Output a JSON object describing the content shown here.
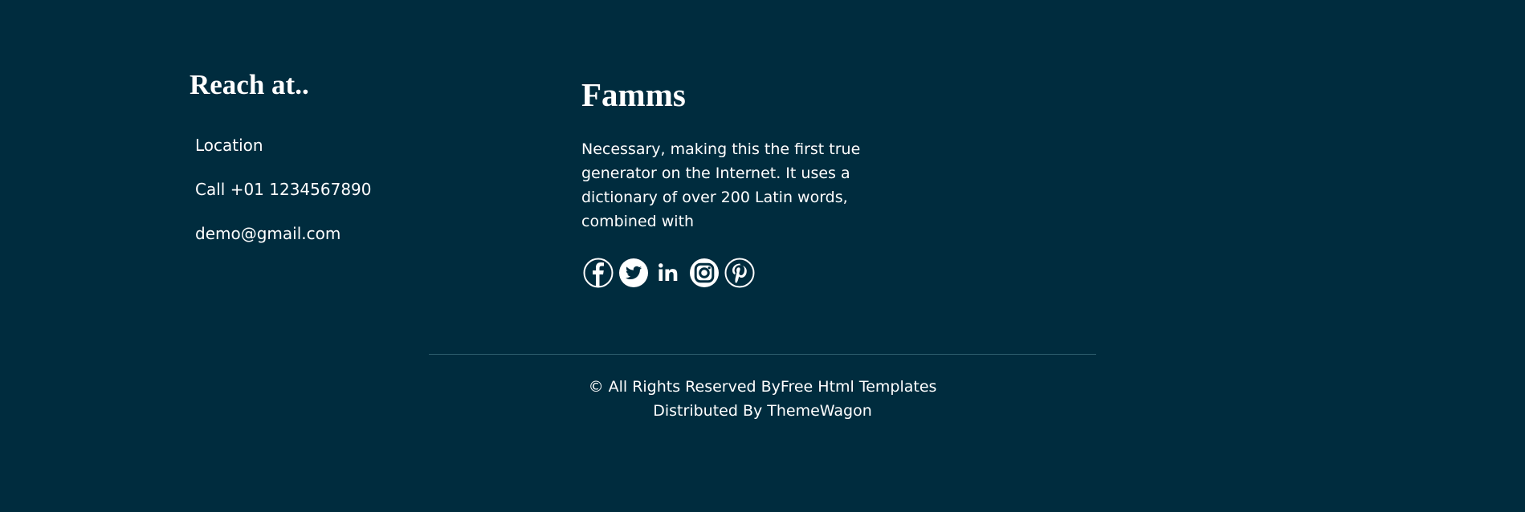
{
  "contact": {
    "heading": "Reach at..",
    "items": [
      {
        "label": "Location"
      },
      {
        "label": "Call +01 1234567890"
      },
      {
        "label": "demo@gmail.com"
      }
    ]
  },
  "brand": {
    "name": "Famms",
    "description": "Necessary, making this the first true generator on the Internet. It uses a dictionary of over 200 Latin words, combined with",
    "social": [
      {
        "icon": "facebook-icon"
      },
      {
        "icon": "twitter-icon"
      },
      {
        "icon": "linkedin-icon"
      },
      {
        "icon": "instagram-icon"
      },
      {
        "icon": "pinterest-icon"
      }
    ]
  },
  "copyright": {
    "line1": "© All Rights Reserved ByFree Html Templates",
    "line2": "Distributed By ThemeWagon"
  },
  "colors": {
    "background": "#002c3e",
    "text": "#ffffff",
    "divider": "#2e5e6e"
  }
}
